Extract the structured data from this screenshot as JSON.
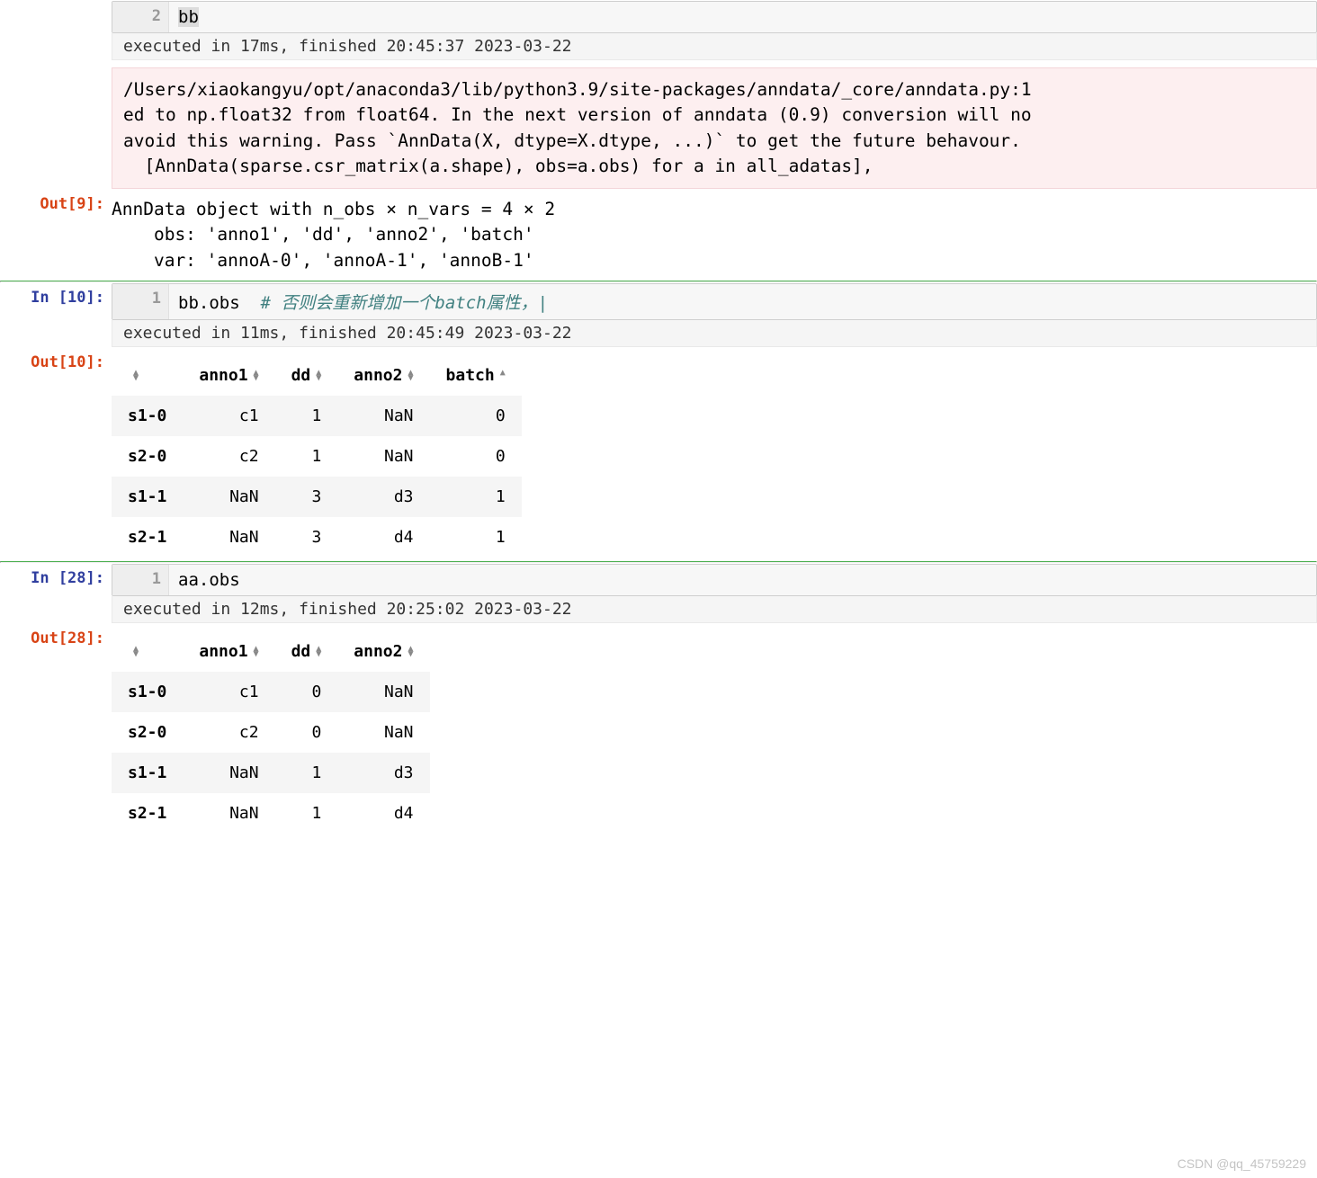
{
  "cell9": {
    "in_prompt": "",
    "out_prompt": "Out[9]:",
    "line_no": "2",
    "code_selected": "bb",
    "exec_msg": "executed in 17ms, finished 20:45:37 2023-03-22",
    "warn_line1": "/Users/xiaokangyu/opt/anaconda3/lib/python3.9/site-packages/anndata/_core/anndata.py:1",
    "warn_line2": "ed to np.float32 from float64. In the next version of anndata (0.9) conversion will no",
    "warn_line3": "avoid this warning. Pass `AnnData(X, dtype=X.dtype, ...)` to get the future behavour.",
    "warn_line4": "  [AnnData(sparse.csr_matrix(a.shape), obs=a.obs) for a in all_adatas],",
    "out_line1": "AnnData object with n_obs × n_vars = 4 × 2",
    "out_line2": "    obs: 'anno1', 'dd', 'anno2', 'batch'",
    "out_line3": "    var: 'annoA-0', 'annoA-1', 'annoB-1'"
  },
  "cell10": {
    "in_prompt": "In [10]:",
    "out_prompt": "Out[10]:",
    "line_no": "1",
    "code_prefix": "bb.obs  ",
    "code_comment": "# 否则会重新增加一个batch属性，|",
    "exec_msg": "executed in 11ms, finished 20:45:49 2023-03-22",
    "columns": [
      "",
      "anno1",
      "dd",
      "anno2",
      "batch"
    ],
    "sort_state": [
      "both",
      "both",
      "both",
      "both",
      "asc"
    ],
    "rows": [
      {
        "idx": "s1-0",
        "anno1": "c1",
        "dd": "1",
        "anno2": "NaN",
        "batch": "0"
      },
      {
        "idx": "s2-0",
        "anno1": "c2",
        "dd": "1",
        "anno2": "NaN",
        "batch": "0"
      },
      {
        "idx": "s1-1",
        "anno1": "NaN",
        "dd": "3",
        "anno2": "d3",
        "batch": "1"
      },
      {
        "idx": "s2-1",
        "anno1": "NaN",
        "dd": "3",
        "anno2": "d4",
        "batch": "1"
      }
    ]
  },
  "cell28": {
    "in_prompt": "In [28]:",
    "out_prompt": "Out[28]:",
    "line_no": "1",
    "code": "aa.obs",
    "exec_msg": "executed in 12ms, finished 20:25:02 2023-03-22",
    "columns": [
      "",
      "anno1",
      "dd",
      "anno2"
    ],
    "sort_state": [
      "both",
      "both",
      "both",
      "both"
    ],
    "rows": [
      {
        "idx": "s1-0",
        "anno1": "c1",
        "dd": "0",
        "anno2": "NaN"
      },
      {
        "idx": "s2-0",
        "anno1": "c2",
        "dd": "0",
        "anno2": "NaN"
      },
      {
        "idx": "s1-1",
        "anno1": "NaN",
        "dd": "1",
        "anno2": "d3"
      },
      {
        "idx": "s2-1",
        "anno1": "NaN",
        "dd": "1",
        "anno2": "d4"
      }
    ]
  },
  "watermark": "CSDN @qq_45759229"
}
